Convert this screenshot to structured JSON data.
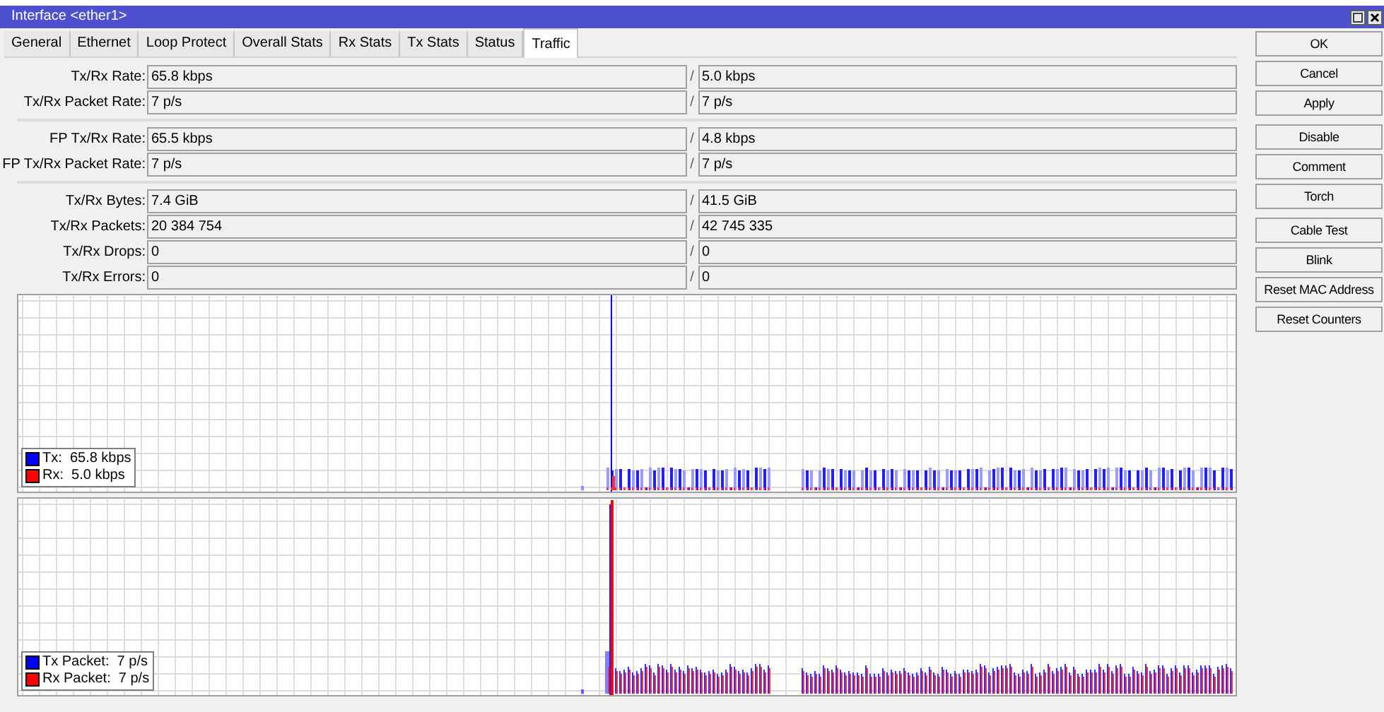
{
  "window": {
    "title": "Interface <ether1>"
  },
  "tabs": [
    {
      "label": "General",
      "selected": false
    },
    {
      "label": "Ethernet",
      "selected": false
    },
    {
      "label": "Loop Protect",
      "selected": false
    },
    {
      "label": "Overall Stats",
      "selected": false
    },
    {
      "label": "Rx Stats",
      "selected": false
    },
    {
      "label": "Tx Stats",
      "selected": false
    },
    {
      "label": "Status",
      "selected": false
    },
    {
      "label": "Traffic",
      "selected": true
    }
  ],
  "field_groups": [
    [
      {
        "label": "Tx/Rx Rate:",
        "tx": "65.8 kbps",
        "separator": "/",
        "rx": "5.0 kbps"
      },
      {
        "label": "Tx/Rx Packet Rate:",
        "tx": "7 p/s",
        "separator": "/",
        "rx": "7 p/s"
      }
    ],
    [
      {
        "label": "FP Tx/Rx Rate:",
        "tx": "65.5 kbps",
        "separator": "/",
        "rx": "4.8 kbps"
      },
      {
        "label": "FP Tx/Rx Packet Rate:",
        "tx": "7 p/s",
        "separator": "/",
        "rx": "7 p/s"
      }
    ],
    [
      {
        "label": "Tx/Rx Bytes:",
        "tx": "7.4 GiB",
        "separator": "/",
        "rx": "41.5 GiB"
      },
      {
        "label": "Tx/Rx Packets:",
        "tx": "20 384 754",
        "separator": "/",
        "rx": "42 745 335"
      },
      {
        "label": "Tx/Rx Drops:",
        "tx": "0",
        "separator": "/",
        "rx": "0"
      },
      {
        "label": "Tx/Rx Errors:",
        "tx": "0",
        "separator": "/",
        "rx": "0"
      }
    ]
  ],
  "graphs": [
    {
      "kind": "rate",
      "legend": [
        {
          "text": "Tx:  65.8 kbps",
          "color": "#0000ff"
        },
        {
          "text": "Rx:  5.0 kbps",
          "color": "#ff0000"
        }
      ]
    },
    {
      "kind": "packets",
      "legend": [
        {
          "text": "Tx Packet:  7 p/s",
          "color": "#0000ff"
        },
        {
          "text": "Rx Packet:  7 p/s",
          "color": "#ff0000"
        }
      ]
    }
  ],
  "button_groups": [
    [
      "OK",
      "Cancel",
      "Apply"
    ],
    [
      "Disable",
      "Comment",
      "Torch"
    ],
    [
      "Cable Test",
      "Blink",
      "Reset MAC Address",
      "Reset Counters"
    ]
  ]
}
